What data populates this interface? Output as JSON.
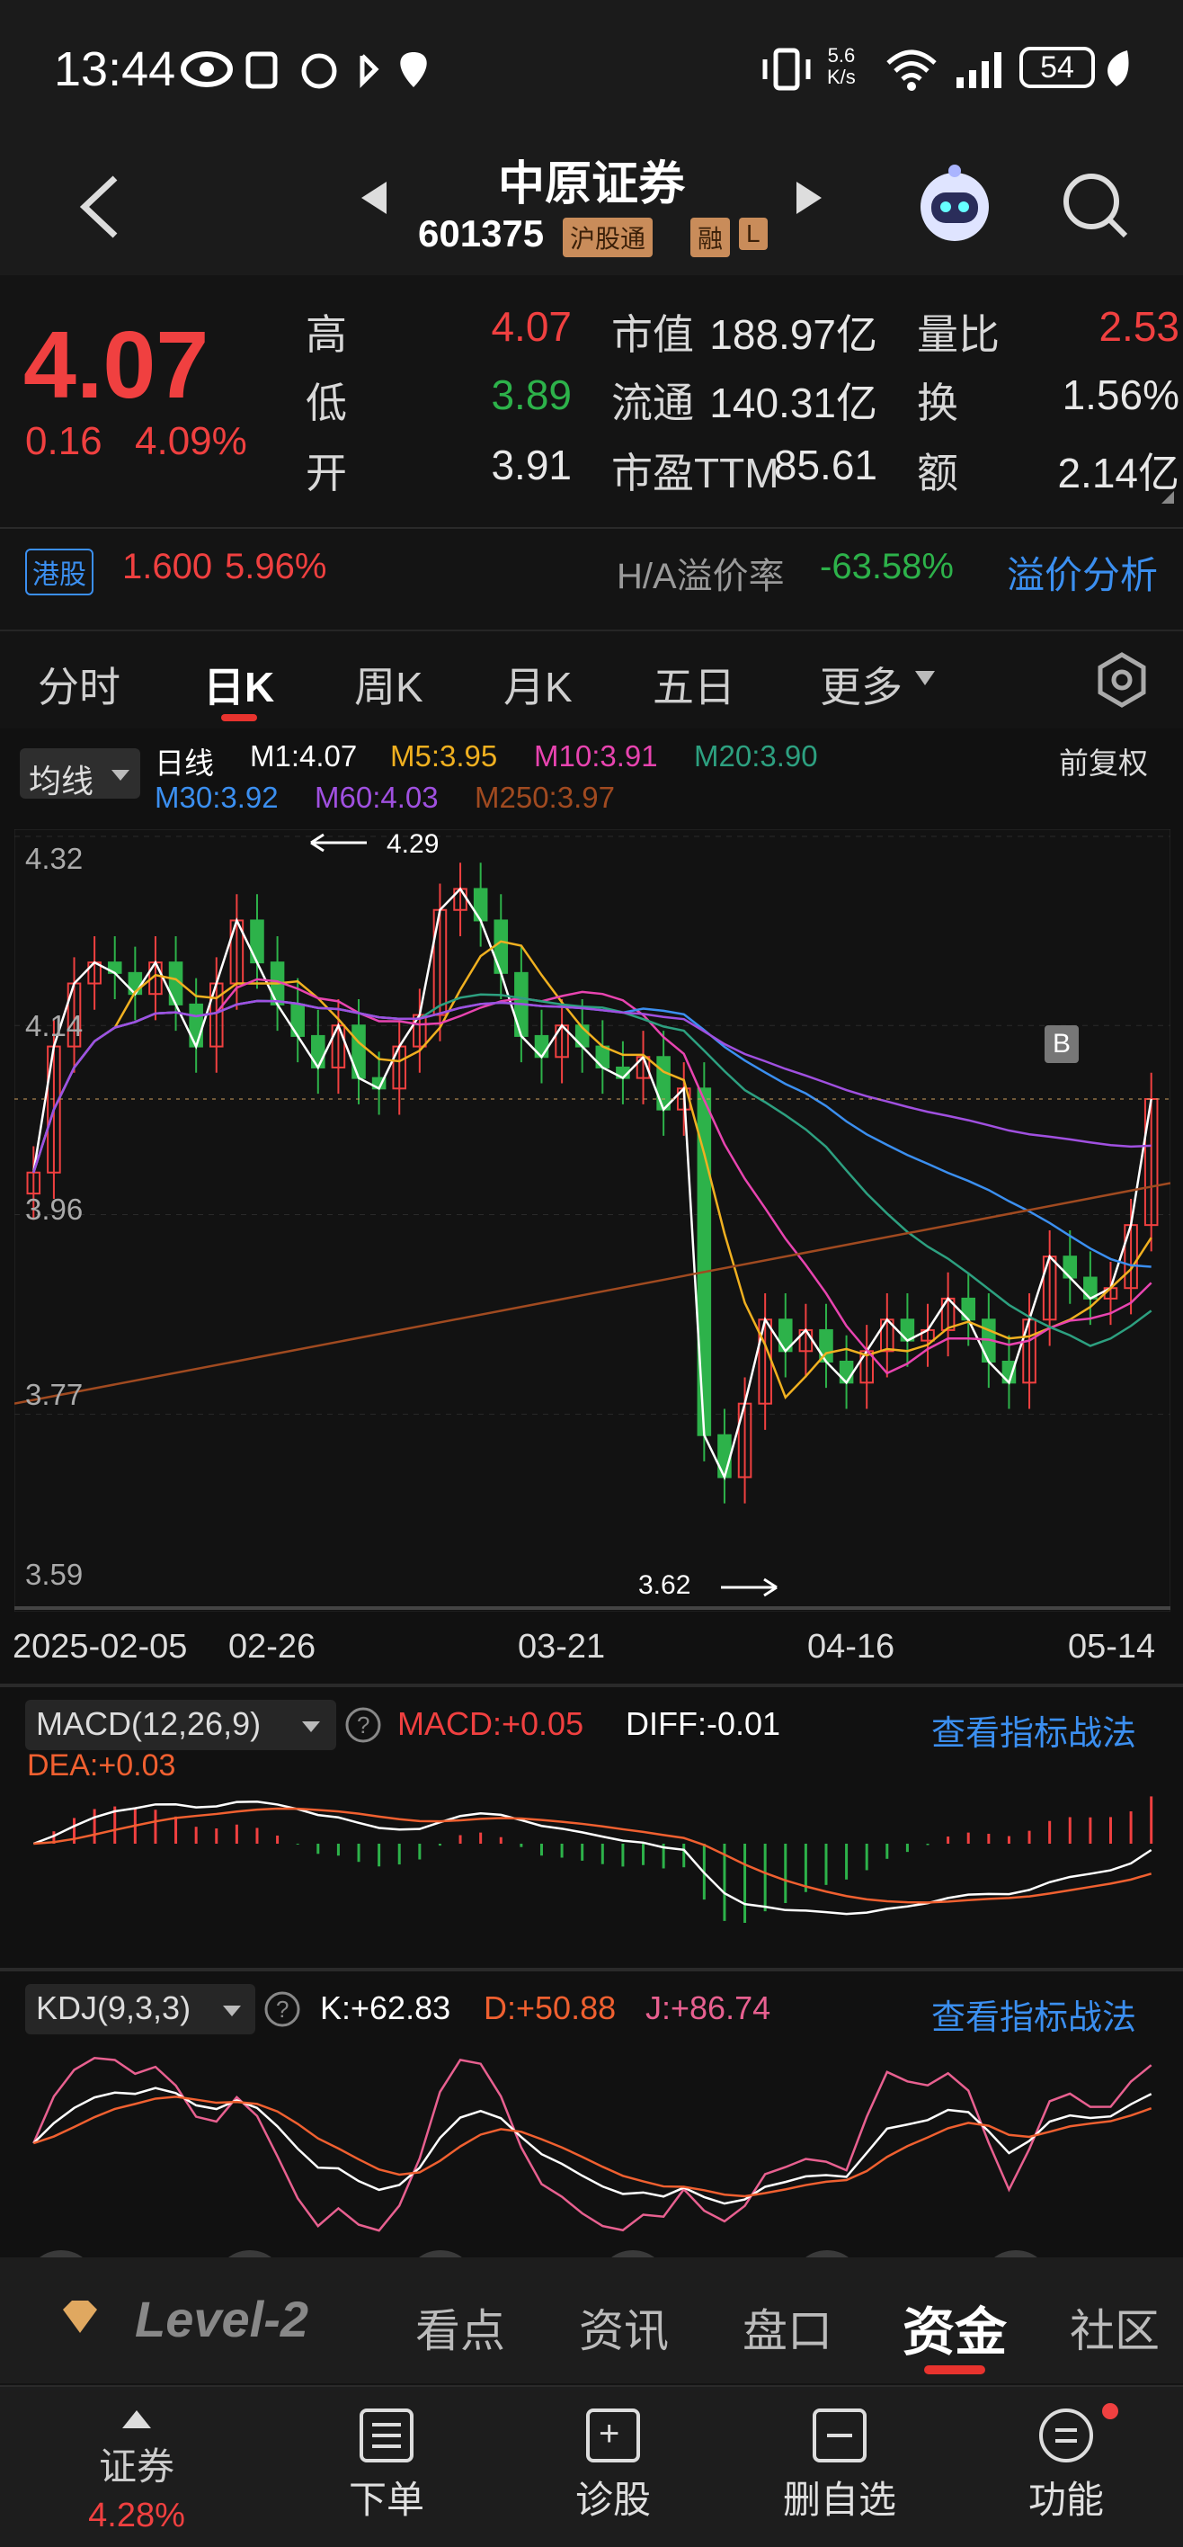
{
  "status": {
    "time": "13:44",
    "net_speed": "5.6",
    "net_unit": "K/s",
    "battery": "54"
  },
  "header": {
    "title": "中原证券",
    "code": "601375",
    "tags": [
      "沪股通",
      "融",
      "L"
    ]
  },
  "quote": {
    "price": "4.07",
    "change": "0.16",
    "change_pct": "4.09%",
    "rows": [
      {
        "l1": "高",
        "v1": "4.07",
        "c1": "red",
        "l2": "市值",
        "v2": "188.97亿",
        "l3": "量比",
        "v3": "2.53",
        "c3": "red"
      },
      {
        "l1": "低",
        "v1": "3.89",
        "c1": "green",
        "l2": "流通",
        "v2": "140.31亿",
        "l3": "换",
        "v3": "1.56%",
        "c3": "white"
      },
      {
        "l1": "开",
        "v1": "3.91",
        "c1": "white",
        "l2": "市盈TTM",
        "v2": "85.61",
        "l3": "额",
        "v3": "2.14亿",
        "c3": "white"
      }
    ]
  },
  "hk": {
    "badge": "港股",
    "price": "1.600",
    "pct": "5.96%",
    "premium_label": "H/A溢价率",
    "premium": "-63.58%",
    "link": "溢价分析"
  },
  "tabs": [
    "分时",
    "日K",
    "周K",
    "月K",
    "五日",
    "更多"
  ],
  "active_tab": "日K",
  "legend": {
    "ma_btn": "均线",
    "period": "日线",
    "m1": "M1:4.07",
    "m5": "M5:3.95",
    "m10": "M10:3.91",
    "m20": "M20:3.90",
    "m30": "M30:3.92",
    "m60": "M60:4.03",
    "m250": "M250:3.97",
    "adjust": "前复权"
  },
  "axis": {
    "y": [
      "4.32",
      "4.14",
      "3.96",
      "3.77",
      "3.59"
    ],
    "x": [
      "2025-02-05",
      "02-26",
      "03-21",
      "04-16",
      "05-14"
    ]
  },
  "annotations": {
    "high": "4.29",
    "low": "3.62",
    "marker": "B"
  },
  "macd": {
    "btn": "MACD(12,26,9)",
    "macd": "MACD:+0.05",
    "diff": "DIFF:-0.01",
    "dea": "DEA:+0.03",
    "link": "查看指标战法"
  },
  "kdj": {
    "btn": "KDJ(9,3,3)",
    "k": "K:+62.83",
    "d": "D:+50.88",
    "j": "J:+86.74",
    "link": "查看指标战法"
  },
  "level_tabs": [
    "Level-2",
    "看点",
    "资讯",
    "盘口",
    "资金",
    "社区"
  ],
  "bottom_nav": [
    {
      "label": "证券",
      "sub": "4.28%"
    },
    {
      "label": "下单"
    },
    {
      "label": "诊股"
    },
    {
      "label": "删自选"
    },
    {
      "label": "功能"
    }
  ],
  "colors": {
    "up": "#f04040",
    "down": "#2db24a",
    "accent": "#3b8ff0",
    "active_underline": "#e8332e"
  },
  "chart_data": {
    "type": "candlestick",
    "ylim": [
      3.59,
      4.32
    ],
    "close_series": [
      4.0,
      4.12,
      4.18,
      4.2,
      4.19,
      4.17,
      4.2,
      4.16,
      4.12,
      4.18,
      4.24,
      4.2,
      4.16,
      4.13,
      4.1,
      4.14,
      4.09,
      4.08,
      4.12,
      4.15,
      4.25,
      4.27,
      4.24,
      4.19,
      4.13,
      4.11,
      4.14,
      4.12,
      4.1,
      4.09,
      4.11,
      4.06,
      4.08,
      3.75,
      3.71,
      3.78,
      3.86,
      3.83,
      3.85,
      3.82,
      3.8,
      3.83,
      3.86,
      3.84,
      3.85,
      3.88,
      3.86,
      3.82,
      3.8,
      3.86,
      3.92,
      3.9,
      3.88,
      3.89,
      3.95,
      4.07
    ]
  }
}
